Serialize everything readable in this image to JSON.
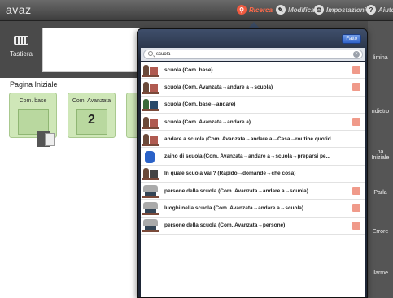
{
  "topbar": {
    "brand": "avaz",
    "nav": [
      {
        "label": "Ricerca",
        "icon": "search-icon",
        "color": "#ff6a4a"
      },
      {
        "label": "Modifica",
        "icon": "edit-icon"
      },
      {
        "label": "Impostazioni",
        "icon": "gear-icon"
      },
      {
        "label": "Aiuto",
        "icon": "help-icon"
      }
    ]
  },
  "appbar": {
    "keyboard_label": "Tastiera",
    "right_labels": [
      "limina",
      "ndietro",
      "na Iniziale",
      "Parla",
      "Errore",
      "llarme"
    ]
  },
  "home": {
    "title": "Pagina Iniziale",
    "tiles": [
      {
        "label": "Com. base"
      },
      {
        "label": "Com. Avanzata",
        "number": "2"
      }
    ]
  },
  "popover": {
    "done_label": "Fatto",
    "search_value": "scuola",
    "results": [
      {
        "label": "scuola (Com. base)",
        "folder": true
      },
      {
        "label": "scuola (Com. Avanzata→andare a→scuola)",
        "folder": true
      },
      {
        "label": "scuola (Com. base→andare)",
        "folder": false
      },
      {
        "label": "scuola (Com. Avanzata→andare a)",
        "folder": true
      },
      {
        "label": "andare a scuola (Com. Avanzata→andare a→Casa→routine quotid...",
        "folder": false
      },
      {
        "label": "zaino di scuola (Com. Avanzata→andare a→scuola→preparsi pe...",
        "folder": false
      },
      {
        "label": "In quale scuola vai ? (Rapido→domande→che cosa)",
        "folder": false
      },
      {
        "label": "persone della scuola (Com. Avanzata→andare a→scuola)",
        "folder": true
      },
      {
        "label": "luoghi nella scuola (Com. Avanzata→andare a→scuola)",
        "folder": true
      },
      {
        "label": "persone della scuola (Com. Avanzata→persone)",
        "folder": true
      }
    ]
  }
}
